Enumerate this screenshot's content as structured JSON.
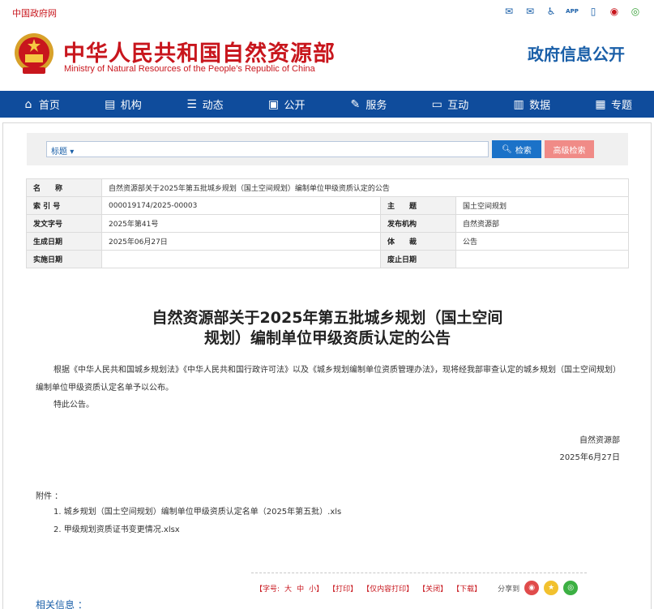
{
  "topbar": {
    "gov_link": "中国政府网",
    "icons": [
      "mail-icon",
      "feedback-icon",
      "accessibility-icon",
      "app-icon",
      "mobile-icon",
      "weibo-icon",
      "wechat-icon"
    ],
    "icon_labels": [
      "✉",
      "✉",
      "♿",
      "APP",
      "▯",
      "◉",
      "◎"
    ],
    "app_text": "APP"
  },
  "header": {
    "title": "中华人民共和国自然资源部",
    "subtitle": "Ministry of Natural Resources of the People’s Republic of China",
    "gov_info": "政府信息公开"
  },
  "nav": {
    "items": [
      {
        "label": "首页",
        "icon": "home-icon",
        "glyph": "⌂"
      },
      {
        "label": "机构",
        "icon": "institution-icon",
        "glyph": "▤"
      },
      {
        "label": "动态",
        "icon": "news-icon",
        "glyph": "☰"
      },
      {
        "label": "公开",
        "icon": "disclosure-icon",
        "glyph": "▣"
      },
      {
        "label": "服务",
        "icon": "service-icon",
        "glyph": "✎"
      },
      {
        "label": "互动",
        "icon": "interaction-icon",
        "glyph": "▭"
      },
      {
        "label": "数据",
        "icon": "data-icon",
        "glyph": "▥"
      },
      {
        "label": "专题",
        "icon": "topic-icon",
        "glyph": "▦"
      }
    ]
  },
  "search": {
    "category": "标题",
    "value": "",
    "search_label": "检索",
    "advanced_label": "高级检索"
  },
  "meta": {
    "name_label": "名　　称",
    "name_value": "自然资源部关于2025年第五批城乡规划（国土空间规划）编制单位甲级资质认定的公告",
    "index_label": "索 引 号",
    "index_value": "000019174/2025-00003",
    "topic_label": "主　　题",
    "topic_value": "国土空间规划",
    "docno_label": "发文字号",
    "docno_value": "2025年第41号",
    "issuer_label": "发布机构",
    "issuer_value": "自然资源部",
    "date_label": "生成日期",
    "date_value": "2025年06月27日",
    "genre_label": "体　　裁",
    "genre_value": "公告",
    "effective_label": "实施日期",
    "effective_value": "",
    "repeal_label": "废止日期",
    "repeal_value": ""
  },
  "doc": {
    "title_line1": "自然资源部关于2025年第五批城乡规划（国土空间",
    "title_line2": "规划）编制单位甲级资质认定的公告",
    "para1": "根据《中华人民共和国城乡规划法》《中华人民共和国行政许可法》以及《城乡规划编制单位资质管理办法》，现将经我部审查认定的城乡规划（国土空间规划）编制单位甲级资质认定名单予以公布。",
    "para2": "特此公告。",
    "sign_org": "自然资源部",
    "sign_date": "2025年6月27日",
    "attach_label": "附件 ：",
    "attachments": [
      "1. 城乡规划（国土空间规划）编制单位甲级资质认定名单（2025年第五批）.xls",
      "2. 甲级规划资质证书变更情况.xlsx"
    ]
  },
  "tools": {
    "font_label": "【字号:",
    "large": "大",
    "medium": "中",
    "small": "小】",
    "print": "【打印】",
    "print_content": "【仅内容打印】",
    "close": "【关闭】",
    "download": "【下载】",
    "share_label": "分享到"
  },
  "related": {
    "label": "相关信息 ："
  },
  "colors": {
    "brand_red": "#c8161d",
    "nav_blue": "#0f4c9c",
    "link_blue": "#1a5fa8",
    "search_blue": "#1b72c8",
    "advanced_pink": "#f08b87"
  }
}
